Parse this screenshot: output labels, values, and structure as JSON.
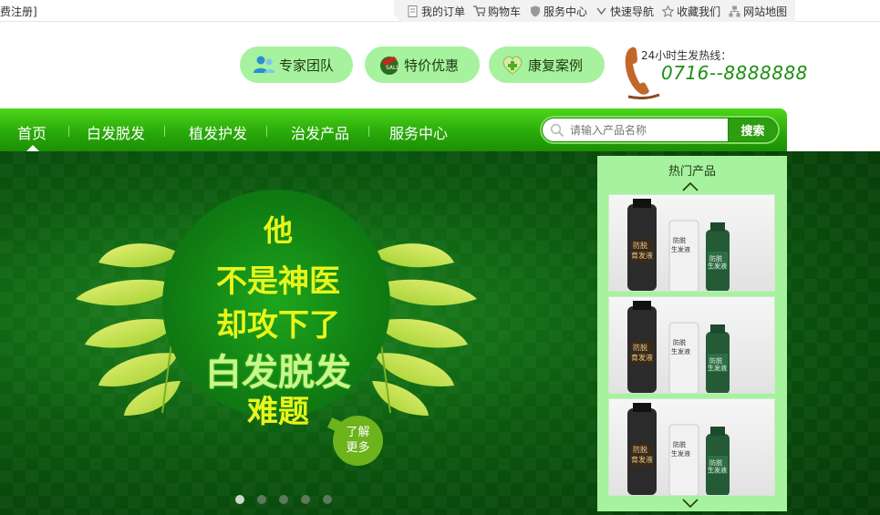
{
  "topbar": {
    "login_text": "费注册]",
    "links": [
      {
        "label": "我的订单",
        "icon": "document-icon"
      },
      {
        "label": "购物车",
        "icon": "cart-icon"
      },
      {
        "label": "服务中心",
        "icon": "shield-icon"
      },
      {
        "label": "快速导航",
        "icon": "chevron-down-icon"
      },
      {
        "label": "收藏我们",
        "icon": "star-icon"
      },
      {
        "label": "网站地图",
        "icon": "sitemap-icon"
      }
    ]
  },
  "header": {
    "pills": [
      {
        "label": "专家团队",
        "icon": "team-icon"
      },
      {
        "label": "特价优惠",
        "icon": "sale-tag-icon"
      },
      {
        "label": "康复案例",
        "icon": "medical-cross-icon"
      }
    ],
    "hotline_label": "24小时生发热线：",
    "hotline_number": "0716--8888888"
  },
  "nav": {
    "items": [
      "首页",
      "白发脱发",
      "植发护发",
      "治发产品",
      "服务中心"
    ],
    "active_index": 0,
    "search_placeholder": "请输入产品名称",
    "search_button": "搜索"
  },
  "banner": {
    "line1": "他",
    "line2": "不是神医",
    "line3": "却攻下了",
    "line4": "白发脱发",
    "line5": "难题",
    "more_label": "了解\n更多",
    "slide_count": 5,
    "active_slide": 0
  },
  "hot_products": {
    "title": "热门产品",
    "products": [
      {
        "labels": [
          "防脱",
          "育发液",
          "防脱",
          "生发液",
          "防脱",
          "生发液"
        ]
      },
      {
        "labels": [
          "防脱",
          "育发液",
          "防脱",
          "生发液",
          "防脱",
          "生发液"
        ]
      },
      {
        "labels": [
          "防脱",
          "育发液",
          "防脱",
          "生发液",
          "防脱",
          "生发液"
        ]
      }
    ]
  },
  "colors": {
    "brand_green": "#2aaa0a",
    "pill_green": "#a6f29e",
    "hotline_green": "#1f8f12",
    "slogan_yellow": "#e8f51b"
  }
}
